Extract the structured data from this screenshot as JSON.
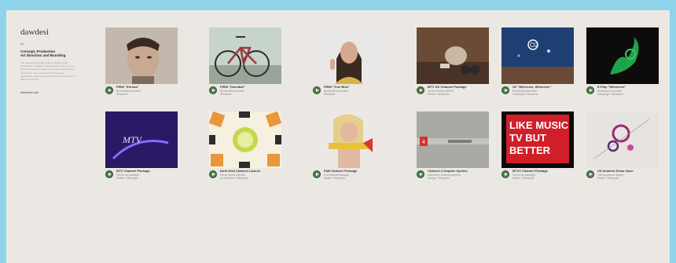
{
  "sidebar": {
    "brand": "dawdesi",
    "small_line": "by",
    "title_line1": "Concept, Production",
    "title_line2": "Art Direction and Branding",
    "description": "The selected work here within includes brand identities for broadcast, television promotion, music video and concept design for cinema, television and the internet. The work shows the range of approaches used to express brands and concepts in different contexts.",
    "link": "dawdesi.com"
  },
  "tiles": [
    {
      "title": "FIRM \"Shroud\"",
      "line1": "Broadcast promotion",
      "line2": "Wirepoint"
    },
    {
      "title": "FIRM \"Cannibal\"",
      "line1": "Broadcast promotion",
      "line2": "Wirepoint"
    },
    {
      "title": "FIRM \"True Blue\"",
      "line1": "Broadcast promotion",
      "line2": "Wirepoint"
    },
    {
      "title": "MTV UK Channel Package",
      "line1": "On-air identity refresh",
      "line2": "Motion / Wirepoint"
    },
    {
      "title": "O2 \"Wherever, Whenever\"",
      "line1": "Broadcast promotion",
      "line2": "Campaign / Wirepoint"
    },
    {
      "title": "E-Play \"Whenever\"",
      "line1": "Broadcast promotion",
      "line2": "Campaign / Wirepoint"
    },
    {
      "title": "MTV Channel Package",
      "line1": "Full on-air package",
      "line2": "Motion / Wirepoint"
    },
    {
      "title": "Ident Kiwi Channel Launch",
      "line1": "On-air launch identity",
      "line2": "Art Direction / Wirepoint"
    },
    {
      "title": "FAB Channel Package",
      "line1": "Full channel package",
      "line2": "Motion / Wirepoint"
    },
    {
      "title": "Channel 4 Graphic System",
      "line1": "Interactive channel graphics",
      "line2": "Design / Wirepoint"
    },
    {
      "title": "MTV2 Channel Package",
      "line1": "Full on-air package",
      "line2": "Motion / Wirepoint"
    },
    {
      "title": "US Ambient Show Open",
      "line1": "Title sequence design",
      "line2": "Motion / Wirepoint"
    }
  ],
  "logo_text": {
    "o2": "O2",
    "mtv": "MTV",
    "like_music_line1": "LIKE MUSIC",
    "like_music_line2": "TV BUT",
    "like_music_line3": "BETTER",
    "channel4_bar": "4"
  }
}
